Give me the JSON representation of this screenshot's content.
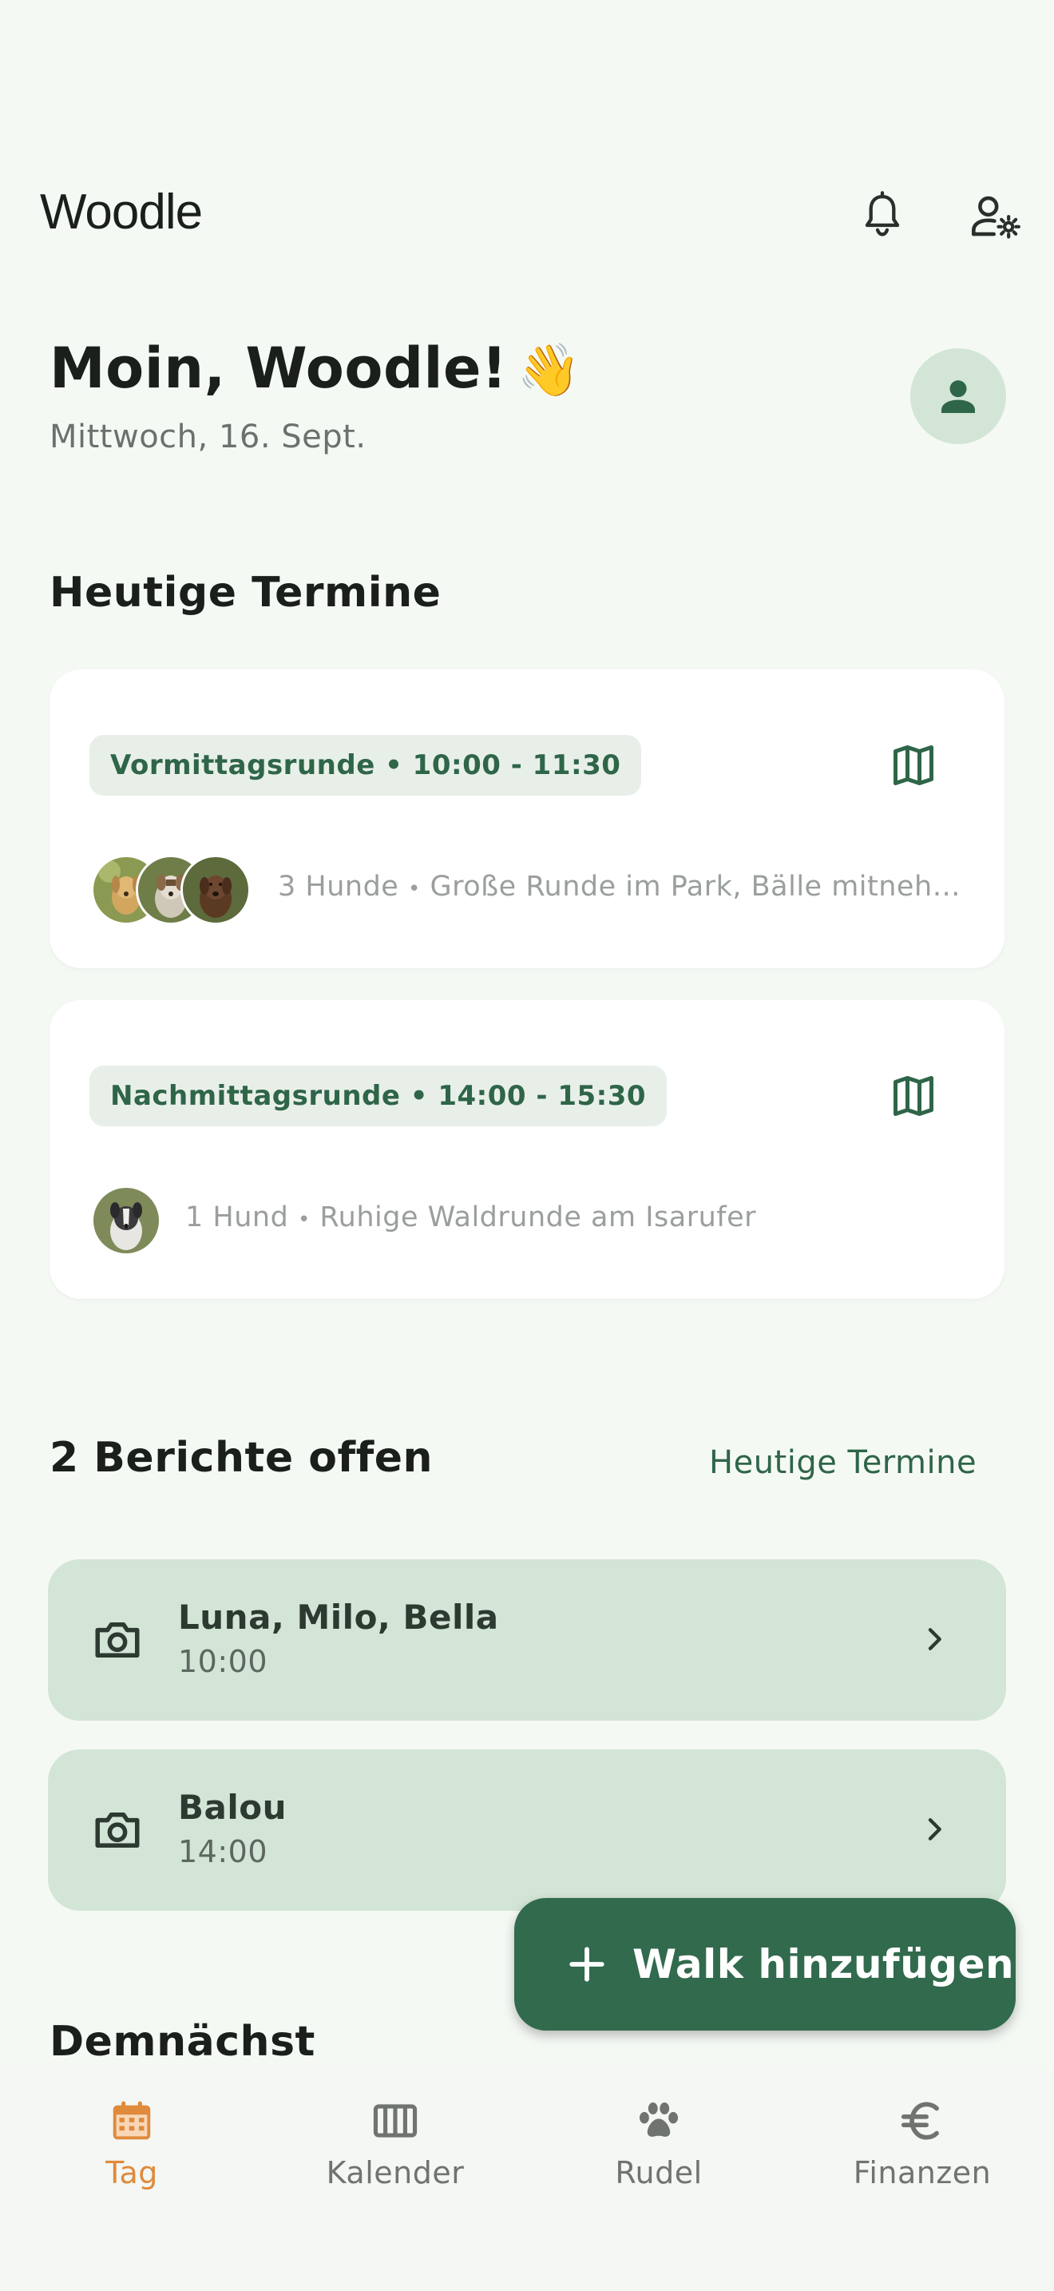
{
  "app": {
    "title": "Woodle"
  },
  "header": {
    "greeting": "Moin, Woodle!",
    "wave_emoji": "👋",
    "date": "Mittwoch, 16. Sept."
  },
  "today": {
    "title": "Heutige Termine",
    "appointments": [
      {
        "label": "Vormittagsrunde • 10:00 - 11:30",
        "dog_count": "3 Hunde",
        "separator": "•",
        "note": "Große Runde im Park, Bälle mitnehm..."
      },
      {
        "label": "Nachmittagsrunde • 14:00 - 15:30",
        "dog_count": "1 Hund",
        "separator": "•",
        "note": "Ruhige Waldrunde am Isarufer"
      }
    ]
  },
  "reports": {
    "title": "2 Berichte offen",
    "link": "Heutige Termine",
    "items": [
      {
        "title": "Luna, Milo, Bella",
        "time": "10:00"
      },
      {
        "title": "Balou",
        "time": "14:00"
      }
    ]
  },
  "upcoming": {
    "title": "Demnächst"
  },
  "fab": {
    "label": "Walk hinzufügen"
  },
  "nav": {
    "items": [
      {
        "label": "Tag",
        "icon": "calendar-icon",
        "active": true
      },
      {
        "label": "Kalender",
        "icon": "view-week-icon",
        "active": false
      },
      {
        "label": "Rudel",
        "icon": "paw-icon",
        "active": false
      },
      {
        "label": "Finanzen",
        "icon": "euro-icon",
        "active": false
      }
    ]
  },
  "colors": {
    "primary": "#326a4d",
    "accent_active": "#e08a3c",
    "background": "#f5f9f4",
    "chip_bg": "#e8efe9",
    "report_bg": "#d3e5d6"
  }
}
